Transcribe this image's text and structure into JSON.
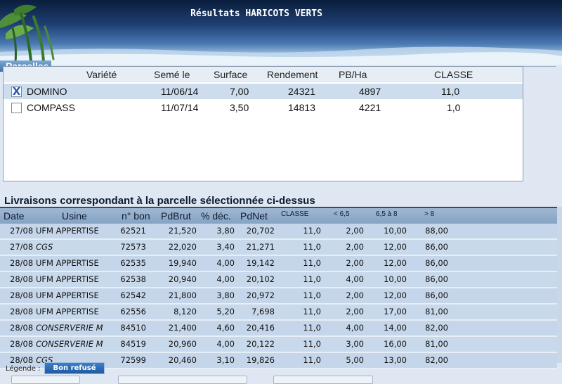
{
  "header": {
    "title": "Résultats HARICOTS VERTS"
  },
  "parcelles": {
    "legend": "Parcelles",
    "columns": [
      "Variété",
      "Semé le",
      "Surface",
      "Rendement",
      "PB/Ha",
      "CLASSE"
    ],
    "rows": [
      {
        "checked": true,
        "check_mark": "X",
        "variete": "DOMINO",
        "seme_le": "11/06/14",
        "surface": "7,00",
        "rendement": "24321",
        "pb_ha": "4897",
        "classe": "11,0"
      },
      {
        "checked": false,
        "check_mark": "",
        "variete": "COMPASS",
        "seme_le": "11/07/14",
        "surface": "3,50",
        "rendement": "14813",
        "pb_ha": "4221",
        "classe": "1,0"
      }
    ]
  },
  "livraisons": {
    "title": "Livraisons correspondant à la parcelle sélectionnée ci-dessus",
    "columns": [
      "Date",
      "Usine",
      "n° bon",
      "PdBrut",
      "% déc.",
      "PdNet",
      "CLASSE",
      "< 6,5",
      "6,5 à 8",
      "> 8"
    ],
    "rows": [
      {
        "date": "27/08",
        "usine": "UFM APPERTISE",
        "bon": "62521",
        "pdbrut": "21,520",
        "dec": "3,80",
        "pdnet": "20,702",
        "classe": "11,0",
        "lt65": "2,00",
        "r65_8": "10,00",
        "gt8": "88,00"
      },
      {
        "date": "27/08",
        "usine": "CGS",
        "bon": "72573",
        "pdbrut": "22,020",
        "dec": "3,40",
        "pdnet": "21,271",
        "classe": "11,0",
        "lt65": "2,00",
        "r65_8": "12,00",
        "gt8": "86,00"
      },
      {
        "date": "28/08",
        "usine": "UFM APPERTISE",
        "bon": "62535",
        "pdbrut": "19,940",
        "dec": "4,00",
        "pdnet": "19,142",
        "classe": "11,0",
        "lt65": "2,00",
        "r65_8": "12,00",
        "gt8": "86,00"
      },
      {
        "date": "28/08",
        "usine": "UFM APPERTISE",
        "bon": "62538",
        "pdbrut": "20,940",
        "dec": "4,00",
        "pdnet": "20,102",
        "classe": "11,0",
        "lt65": "4,00",
        "r65_8": "10,00",
        "gt8": "86,00"
      },
      {
        "date": "28/08",
        "usine": "UFM APPERTISE",
        "bon": "62542",
        "pdbrut": "21,800",
        "dec": "3,80",
        "pdnet": "20,972",
        "classe": "11,0",
        "lt65": "2,00",
        "r65_8": "12,00",
        "gt8": "86,00"
      },
      {
        "date": "28/08",
        "usine": "UFM APPERTISE",
        "bon": "62556",
        "pdbrut": "8,120",
        "dec": "5,20",
        "pdnet": "7,698",
        "classe": "11,0",
        "lt65": "2,00",
        "r65_8": "17,00",
        "gt8": "81,00"
      },
      {
        "date": "28/08",
        "usine": "CONSERVERIE M",
        "bon": "84510",
        "pdbrut": "21,400",
        "dec": "4,60",
        "pdnet": "20,416",
        "classe": "11,0",
        "lt65": "4,00",
        "r65_8": "14,00",
        "gt8": "82,00"
      },
      {
        "date": "28/08",
        "usine": "CONSERVERIE M",
        "bon": "84519",
        "pdbrut": "20,960",
        "dec": "4,00",
        "pdnet": "20,122",
        "classe": "11,0",
        "lt65": "3,00",
        "r65_8": "16,00",
        "gt8": "81,00"
      },
      {
        "date": "28/08",
        "usine": "CGS",
        "bon": "72599",
        "pdbrut": "20,460",
        "dec": "3,10",
        "pdnet": "19,826",
        "classe": "11,0",
        "lt65": "5,00",
        "r65_8": "13,00",
        "gt8": "82,00"
      }
    ]
  },
  "footer": {
    "legend_label": "Légende :",
    "badge": "Bon refusé"
  },
  "colors": {
    "accent": "#1e5aa0",
    "selected_row": "#cdddee",
    "row": "#c6d6ea"
  }
}
